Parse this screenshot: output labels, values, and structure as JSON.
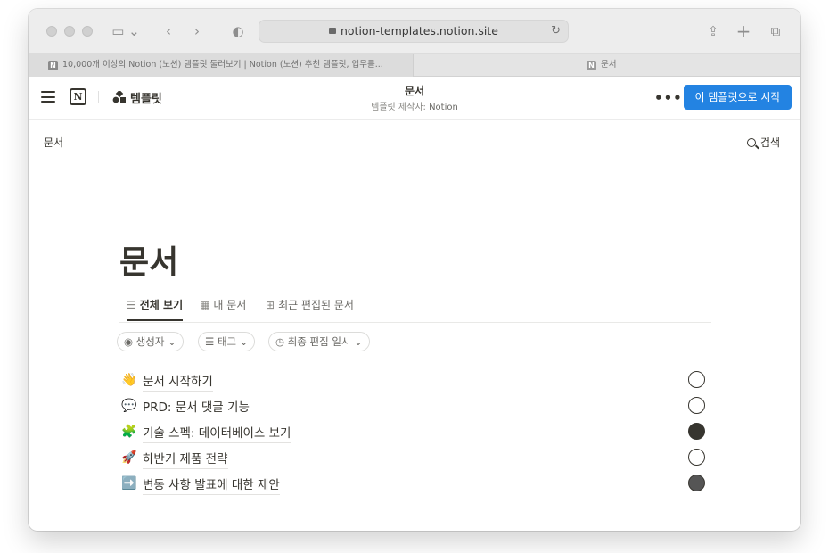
{
  "browser": {
    "url": "notion-templates.notion.site",
    "tabs": [
      {
        "label": "10,000개 이상의 Notion (노션) 템플릿 둘러보기 | Notion (노션) 추천 템플릿, 업무를..."
      },
      {
        "label": "문서"
      }
    ]
  },
  "header": {
    "section_label": "템플릿",
    "page_title": "문서",
    "creator_prefix": "템플릿 제작자:",
    "creator_name": "Notion",
    "more_label": "•••",
    "start_button": "이 템플릿으로 시작"
  },
  "breadcrumb": "문서",
  "search_label": "검색",
  "page": {
    "title": "문서",
    "views": [
      {
        "label": "전체 보기",
        "icon": "list-icon"
      },
      {
        "label": "내 문서",
        "icon": "table-icon"
      },
      {
        "label": "최근 편집된 문서",
        "icon": "gallery-icon"
      }
    ],
    "filters": [
      {
        "label": "생성자",
        "icon": "person-icon"
      },
      {
        "label": "태그",
        "icon": "list-icon"
      },
      {
        "label": "최종 편집 일시",
        "icon": "clock-icon"
      }
    ],
    "rows": [
      {
        "emoji": "👋",
        "title": "문서 시작하기"
      },
      {
        "emoji": "💬",
        "title": "PRD: 문서 댓글 기능"
      },
      {
        "emoji": "🧩",
        "title": "기술 스펙: 데이터베이스 보기"
      },
      {
        "emoji": "🚀",
        "title": "하반기 제품 전략"
      },
      {
        "emoji": "➡️",
        "title": "변동 사항 발표에 대한 제안"
      }
    ]
  },
  "colors": {
    "accent": "#2383e2",
    "text": "#37352f",
    "muted": "#8a8985"
  }
}
